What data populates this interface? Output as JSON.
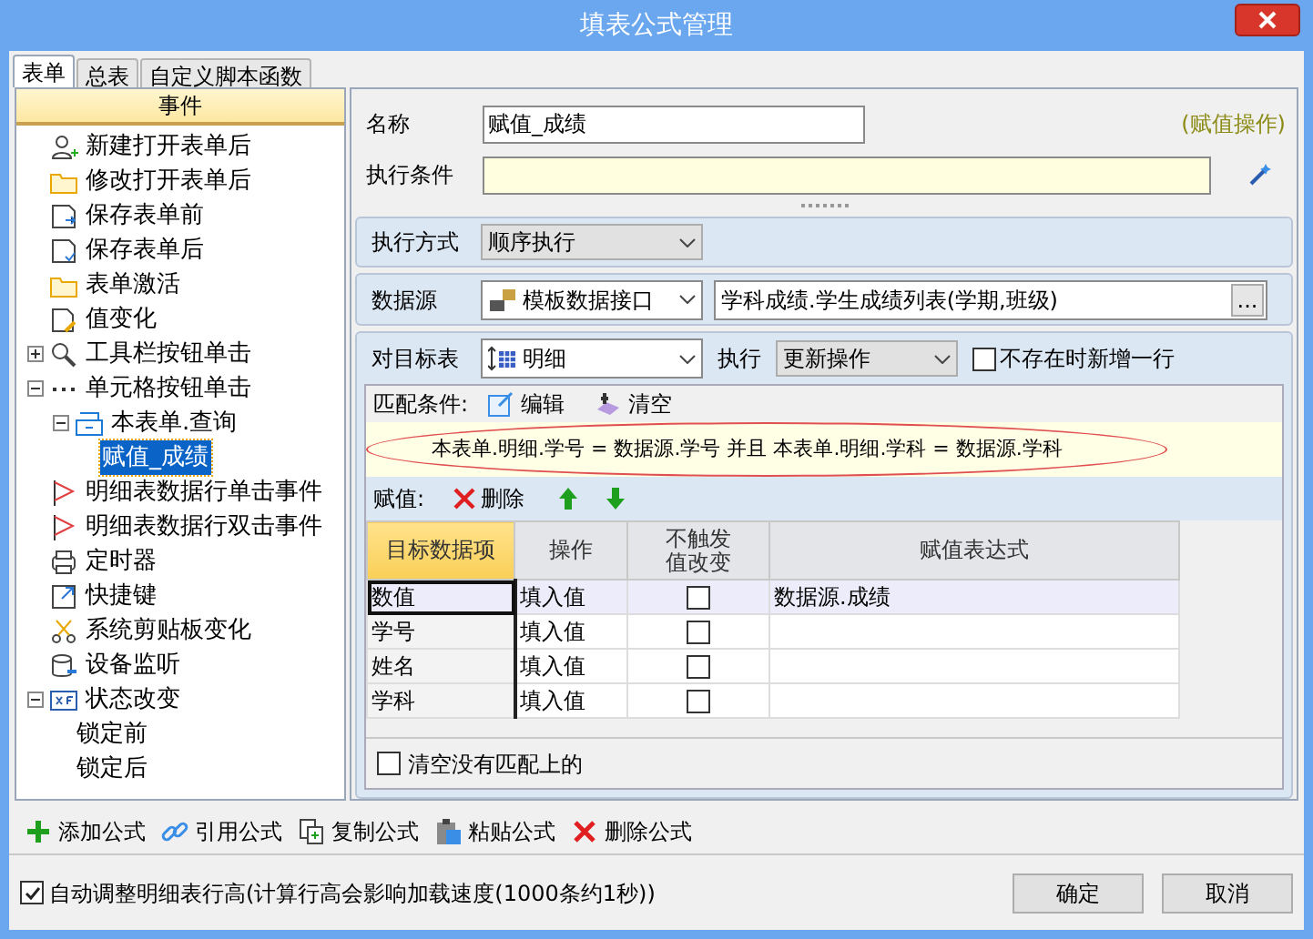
{
  "window": {
    "title": "填表公式管理"
  },
  "tabs": [
    {
      "label": "表单",
      "selected": true
    },
    {
      "label": "总表",
      "selected": false
    },
    {
      "label": "自定义脚本函数",
      "selected": false
    }
  ],
  "tree": {
    "header": "事件",
    "items": [
      {
        "label": "新建打开表单后",
        "selected": false
      },
      {
        "label": "修改打开表单后",
        "selected": false
      },
      {
        "label": "保存表单前",
        "selected": false
      },
      {
        "label": "保存表单后",
        "selected": false
      },
      {
        "label": "表单激活",
        "selected": false
      },
      {
        "label": "值变化",
        "selected": false
      },
      {
        "label": "工具栏按钮单击",
        "selected": false,
        "expanded": false
      },
      {
        "label": "单元格按钮单击",
        "selected": false,
        "expanded": true,
        "children": [
          {
            "label": "本表单.查询",
            "selected": false,
            "expanded": true,
            "children": [
              {
                "label": "赋值_成绩",
                "selected": true
              }
            ]
          }
        ]
      },
      {
        "label": "明细表数据行单击事件",
        "selected": false
      },
      {
        "label": "明细表数据行双击事件",
        "selected": false
      },
      {
        "label": "定时器",
        "selected": false
      },
      {
        "label": "快捷键",
        "selected": false
      },
      {
        "label": "系统剪贴板变化",
        "selected": false
      },
      {
        "label": "设备监听",
        "selected": false
      },
      {
        "label": "状态改变",
        "selected": false,
        "expanded": true,
        "children": [
          {
            "label": "锁定前",
            "selected": false
          },
          {
            "label": "锁定后",
            "selected": false
          }
        ]
      }
    ]
  },
  "form": {
    "name_label": "名称",
    "name_value": "赋值_成绩",
    "kind_note": "(赋值操作)",
    "condition_label": "执行条件",
    "mode_label": "执行方式",
    "mode_value": "顺序执行",
    "source_label": "数据源",
    "source_type": "模板数据接口",
    "source_value": "学科成绩.学生成绩列表(学期,班级)",
    "browse_button": "...",
    "target_label": "对目标表",
    "target_value": "明细",
    "exec_label": "执行",
    "exec_value": "更新操作",
    "add_if_missing": {
      "label": "不存在时新增一行",
      "checked": false
    }
  },
  "match": {
    "label": "匹配条件:",
    "edit_button": "编辑",
    "clear_button": "清空",
    "expression": "本表单.明细.学号 = 数据源.学号 并且 本表单.明细.学科 = 数据源.学科"
  },
  "assign": {
    "label": "赋值:",
    "delete_button": "删除",
    "columns": [
      {
        "label": "目标数据项",
        "selected": true
      },
      {
        "label": "操作",
        "selected": false
      },
      {
        "label": "不触发值改变",
        "selected": false
      },
      {
        "label": "赋值表达式",
        "selected": false
      }
    ],
    "rows": [
      {
        "target": "数值",
        "op": "填入值",
        "no_trigger": false,
        "expr": "数据源.成绩",
        "selected": true
      },
      {
        "target": "学号",
        "op": "填入值",
        "no_trigger": false,
        "selected": false
      },
      {
        "target": "姓名",
        "op": "填入值",
        "no_trigger": false,
        "selected": false
      },
      {
        "target": "学科",
        "op": "填入值",
        "no_trigger": false,
        "selected": false
      }
    ],
    "clear_unmatched": {
      "label": "清空没有匹配上的",
      "checked": false
    }
  },
  "toolbar": [
    "添加公式",
    "引用公式",
    "复制公式",
    "粘贴公式",
    "删除公式"
  ],
  "auto_height": {
    "label": "自动调整明细表行高(计算行高会影响加载速度(1000条约1秒))",
    "checked": true
  },
  "buttons": [
    "确定",
    "取消"
  ]
}
